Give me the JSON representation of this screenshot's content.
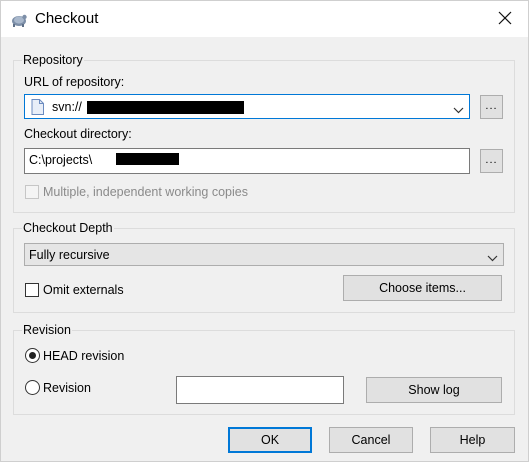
{
  "window": {
    "title": "Checkout",
    "close_icon": "close-icon",
    "app_icon": "tortoisesvn-icon"
  },
  "repository": {
    "group_label": "Repository",
    "url_label": "URL of repository:",
    "url_value": "svn://",
    "browse_label": "...",
    "dir_label": "Checkout directory:",
    "dir_value": "C:\\projects\\",
    "dir_browse_label": "...",
    "multiple_copies_label": "Multiple, independent working copies",
    "multiple_copies_checked": false
  },
  "depth": {
    "group_label": "Checkout Depth",
    "selected": "Fully recursive",
    "omit_externals_label": "Omit externals",
    "omit_externals_checked": false,
    "choose_items_label": "Choose items..."
  },
  "revision": {
    "group_label": "Revision",
    "head_label": "HEAD revision",
    "head_selected": true,
    "rev_label": "Revision",
    "rev_value": "",
    "show_log_label": "Show log"
  },
  "footer": {
    "ok_label": "OK",
    "cancel_label": "Cancel",
    "help_label": "Help"
  }
}
